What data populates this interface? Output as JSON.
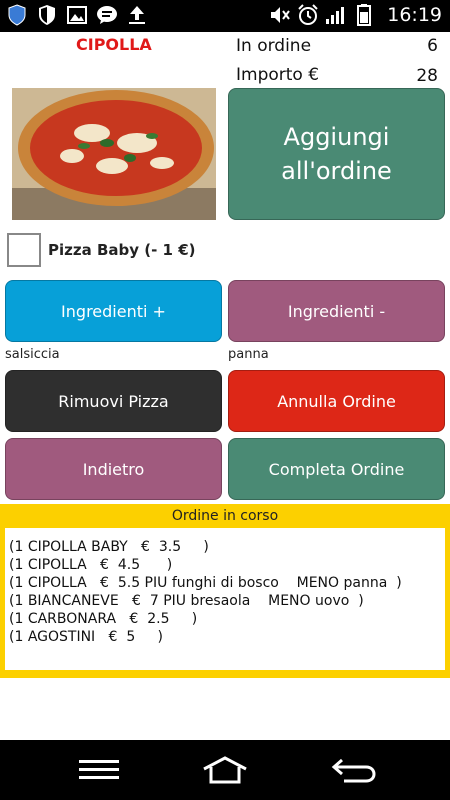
{
  "status_bar": {
    "time": "16:19",
    "left_icons": [
      "shield-icon",
      "shield-outline-icon",
      "image-icon",
      "chat-icon",
      "upload-icon"
    ],
    "right_icons": [
      "mute-icon",
      "alarm-icon",
      "signal-icon",
      "battery-icon"
    ]
  },
  "header": {
    "pizza_name": "CIPOLLA",
    "order_label": "In ordine",
    "order_count": "6",
    "amount_label": "Importo €",
    "amount_value": "28"
  },
  "add_button": {
    "label": "Aggiungi\nall'ordine"
  },
  "baby_option": {
    "label": "Pizza Baby (- 1 €)",
    "checked": false
  },
  "ingredients": {
    "plus_label": "Ingredienti +",
    "minus_label": "Ingredienti -",
    "added": "salsiccia",
    "removed": "panna"
  },
  "actions": {
    "remove_label": "Rimuovi Pizza",
    "cancel_label": "Annulla Ordine",
    "back_label": "Indietro",
    "complete_label": "Completa Ordine"
  },
  "order": {
    "title": "Ordine in corso",
    "lines": [
      "(1 CIPOLLA BABY   €  3.5     )",
      "(1 CIPOLLA   €  4.5      )",
      "(1 CIPOLLA   €  5.5 PIU funghi di bosco    MENO panna  )",
      "(1 BIANCANEVE   €  7 PIU bresaola    MENO uovo  )",
      "(1 CARBONARA   €  2.5     )",
      "(1 AGOSTINI   €  5     )"
    ]
  },
  "colors": {
    "accent_red": "#e01919",
    "green": "#4a8a74",
    "blue": "#07a0d8",
    "purple": "#a05a7e",
    "dark": "#2f2f2f",
    "red_button": "#dd2717",
    "order_panel": "#fcd000"
  },
  "nav_bar": {
    "icons": [
      "menu-icon",
      "home-icon",
      "back-icon"
    ]
  }
}
